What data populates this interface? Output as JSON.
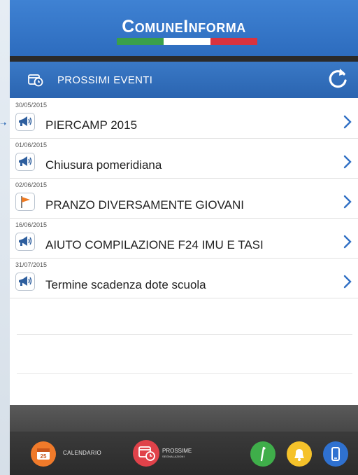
{
  "app": {
    "title": "ComuneInforma",
    "flag_colors": [
      "#3aa04a",
      "#ffffff",
      "#d9333f"
    ]
  },
  "section": {
    "title": "PROSSIMI EVENTI"
  },
  "events": [
    {
      "date": "30/05/2015",
      "title": "PIERCAMP 2015",
      "icon": "megaphone-icon"
    },
    {
      "date": "01/06/2015",
      "title": "Chiusura pomeridiana",
      "icon": "megaphone-icon"
    },
    {
      "date": "02/06/2015",
      "title": "PRANZO DIVERSAMENTE GIOVANI",
      "icon": "flag-icon"
    },
    {
      "date": "16/06/2015",
      "title": "AIUTO COMPILAZIONE F24 IMU E TASI",
      "icon": "megaphone-icon"
    },
    {
      "date": "31/07/2015",
      "title": "Termine scadenza dote scuola",
      "icon": "megaphone-icon"
    }
  ],
  "footer": {
    "calendar_label": "CALENDARIO",
    "calendar_day": "25",
    "prossime_label": "PROSSIME",
    "prossime_sub": "SEGNALAZIONI"
  },
  "colors": {
    "header_blue": "#3a7acb",
    "calendar_orange": "#f07a2a",
    "prossime_red": "#e0424a",
    "info_green": "#3fae4a",
    "bell_yellow": "#f5c22a",
    "phone_blue": "#2f71d0"
  }
}
